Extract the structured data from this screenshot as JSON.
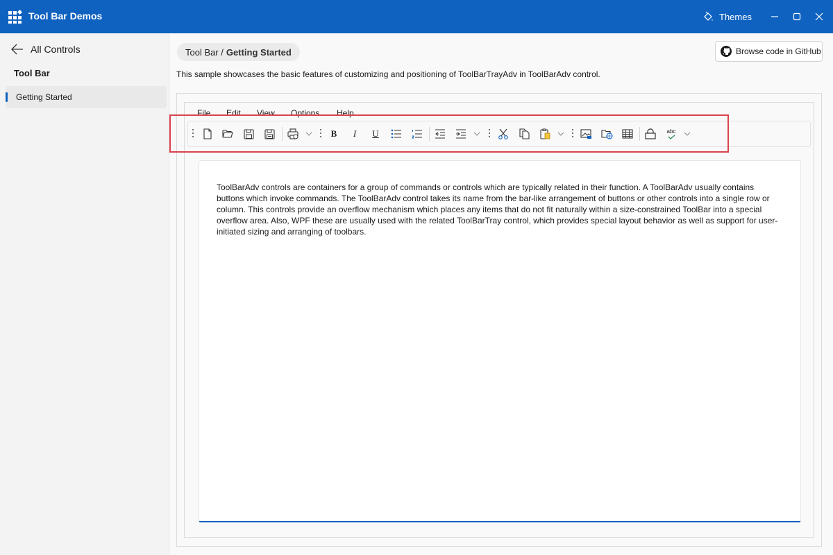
{
  "window": {
    "title": "Tool Bar Demos",
    "themes_label": "Themes",
    "accent_color": "#0f62c0"
  },
  "sidebar": {
    "back_label": "All Controls",
    "heading": "Tool Bar",
    "items": [
      {
        "label": "Getting Started",
        "selected": true
      }
    ]
  },
  "header": {
    "breadcrumb_parent": "Tool Bar /",
    "breadcrumb_current": "Getting Started",
    "github_label": "Browse code in GitHub",
    "description": "This sample showcases the basic features of customizing and positioning of ToolBarTrayAdv in ToolBarAdv control."
  },
  "menu": [
    "File",
    "Edit",
    "View",
    "Options",
    "Help"
  ],
  "toolbar": {
    "bold": "B",
    "italic": "I",
    "underline": "U",
    "spell": "abc",
    "icons": [
      "new-file-icon",
      "open-folder-icon",
      "save-icon",
      "save-all-icon",
      "print-icon",
      "bold-icon",
      "italic-icon",
      "underline-icon",
      "bullet-list-icon",
      "numbered-list-icon",
      "outdent-icon",
      "indent-icon",
      "cut-icon",
      "copy-icon",
      "paste-icon",
      "picture-icon",
      "web-icon",
      "table-icon",
      "lock-icon",
      "spell-check-icon"
    ]
  },
  "editor": {
    "text": "ToolBarAdv controls are containers for a group of commands or controls which are typically related in their function. A ToolBarAdv usually contains buttons which invoke commands. The ToolBarAdv control takes its name from the bar-like arrangement of buttons or other controls into a single row or column. This controls provide an overflow mechanism which places any items that do not fit naturally within a size-constrained ToolBar into a special overflow area. Also, WPF these are usually used with the related ToolBarTray control, which provides special layout behavior as well as support for user-initiated sizing and arranging of toolbars."
  },
  "highlight_color": "#d9434c"
}
